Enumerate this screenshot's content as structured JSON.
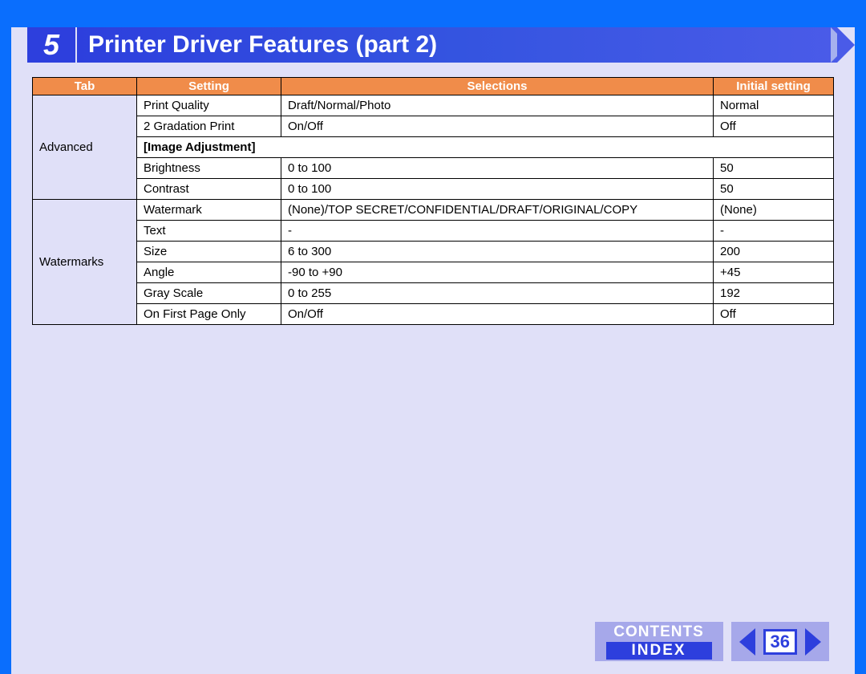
{
  "chapter": "5",
  "title": "Printer Driver Features (part 2)",
  "columns": {
    "tab": "Tab",
    "setting": "Setting",
    "selections": "Selections",
    "initial": "Initial setting"
  },
  "groups": [
    {
      "tab": "Advanced",
      "rows": [
        {
          "setting": "Print Quality",
          "selections": "Draft/Normal/Photo",
          "initial": "Normal",
          "isSection": false
        },
        {
          "setting": "2 Gradation Print",
          "selections": "On/Off",
          "initial": "Off",
          "isSection": false
        },
        {
          "setting": "[Image Adjustment]",
          "selections": "",
          "initial": "",
          "isSection": true
        },
        {
          "setting": "Brightness",
          "selections": "0 to 100",
          "initial": "50",
          "isSection": false
        },
        {
          "setting": "Contrast",
          "selections": "0 to 100",
          "initial": "50",
          "isSection": false
        }
      ]
    },
    {
      "tab": "Watermarks",
      "rows": [
        {
          "setting": "Watermark",
          "selections": "(None)/TOP SECRET/CONFIDENTIAL/DRAFT/ORIGINAL/COPY",
          "initial": "(None)",
          "isSection": false
        },
        {
          "setting": "Text",
          "selections": "-",
          "initial": "-",
          "isSection": false
        },
        {
          "setting": "Size",
          "selections": "6 to 300",
          "initial": "200",
          "isSection": false
        },
        {
          "setting": "Angle",
          "selections": "-90 to +90",
          "initial": "+45",
          "isSection": false
        },
        {
          "setting": "Gray Scale",
          "selections": "0 to 255",
          "initial": "192",
          "isSection": false
        },
        {
          "setting": "On First Page Only",
          "selections": "On/Off",
          "initial": "Off",
          "isSection": false
        }
      ]
    }
  ],
  "footer": {
    "contents": "CONTENTS",
    "index": "INDEX",
    "page": "36"
  }
}
